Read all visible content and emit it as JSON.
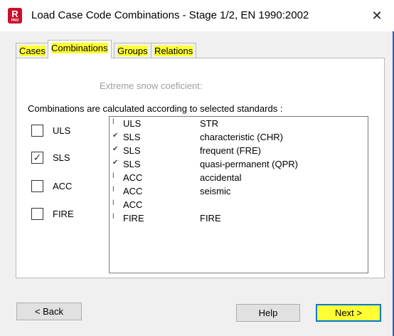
{
  "window": {
    "title": "Load Case Code Combinations - Stage 1/2, EN 1990:2002",
    "app_icon_letter": "R",
    "app_icon_sub": "PRO",
    "close_glyph": "✕"
  },
  "tabs": [
    {
      "label": "Cases",
      "active": false
    },
    {
      "label": "Combinations",
      "active": true
    },
    {
      "label": "Groups",
      "active": false
    },
    {
      "label": "Relations",
      "active": false
    }
  ],
  "panel": {
    "snow_label": "Extreme snow coeficient:",
    "calc_label": "Combinations are calculated according to selected standards :"
  },
  "checkboxes": [
    {
      "label": "ULS",
      "checked": false
    },
    {
      "label": "SLS",
      "checked": true
    },
    {
      "label": "ACC",
      "checked": false
    },
    {
      "label": "FIRE",
      "checked": false
    }
  ],
  "list": [
    {
      "type": "ULS",
      "desc": "STR",
      "checked": false
    },
    {
      "type": "SLS",
      "desc": "characteristic (CHR)",
      "checked": true
    },
    {
      "type": "SLS",
      "desc": "frequent (FRE)",
      "checked": true
    },
    {
      "type": "SLS",
      "desc": "quasi-permanent (QPR)",
      "checked": true
    },
    {
      "type": "ACC",
      "desc": "accidental",
      "checked": false
    },
    {
      "type": "ACC",
      "desc": "seismic",
      "checked": false
    },
    {
      "type": "ACC",
      "desc": "",
      "checked": false
    },
    {
      "type": "FIRE",
      "desc": "FIRE",
      "checked": false
    }
  ],
  "buttons": {
    "back": "< Back",
    "help": "Help",
    "next": "Next >"
  },
  "glyphs": {
    "check": "✓",
    "list_checked": "✔",
    "list_unchecked": "ǀ"
  },
  "colors": {
    "highlight": "#ffff33",
    "accent": "#0078d7",
    "app_icon": "#c8102e"
  }
}
